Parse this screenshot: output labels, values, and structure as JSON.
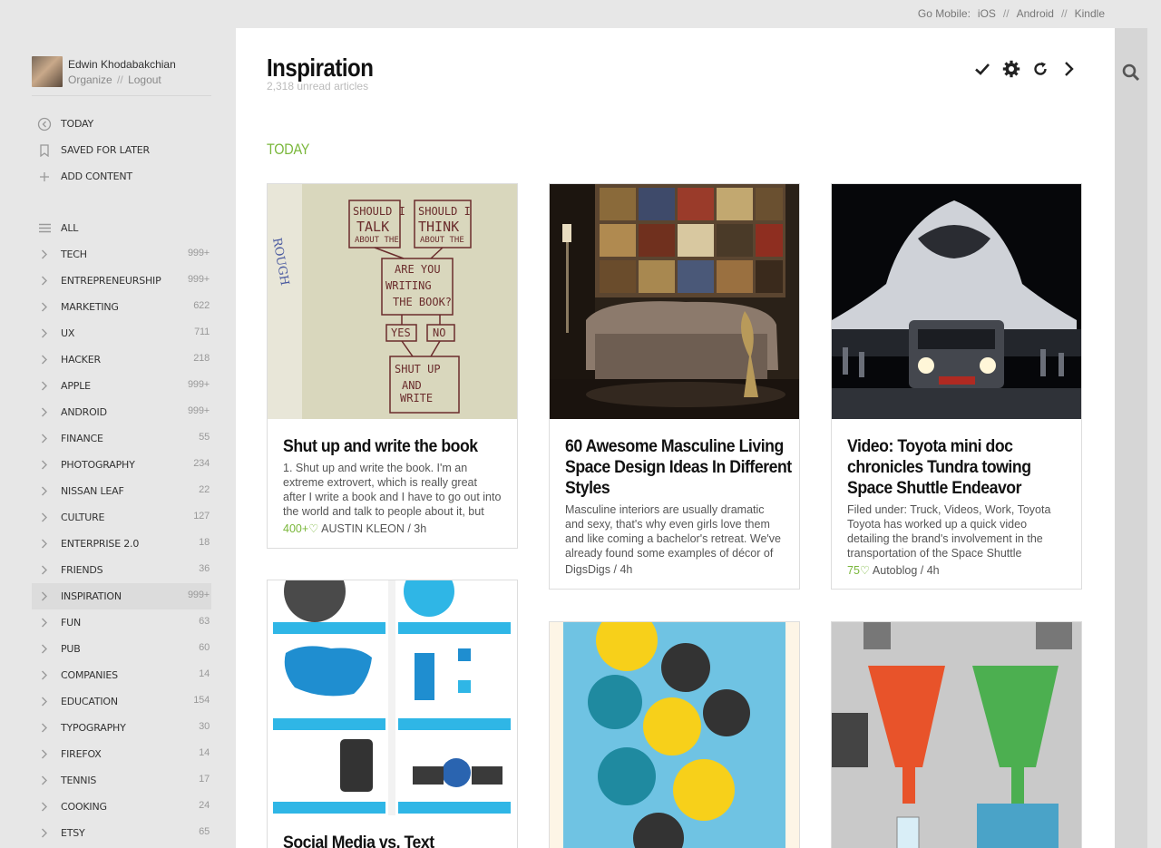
{
  "topbar": {
    "label": "Go Mobile:",
    "links": [
      "iOS",
      "Android",
      "Kindle"
    ],
    "separator": "//"
  },
  "user": {
    "name": "Edwin Khodabakchian",
    "organize": "Organize",
    "separator": "//",
    "logout": "Logout"
  },
  "nav_top": [
    {
      "label": "TODAY",
      "icon": "today-icon"
    },
    {
      "label": "SAVED FOR LATER",
      "icon": "bookmark-icon"
    },
    {
      "label": "ADD CONTENT",
      "icon": "plus-icon"
    }
  ],
  "nav_list": [
    {
      "label": "ALL",
      "count": "",
      "icon": "list-icon"
    },
    {
      "label": "TECH",
      "count": "999+"
    },
    {
      "label": "ENTREPRENEURSHIP",
      "count": "999+"
    },
    {
      "label": "MARKETING",
      "count": "622"
    },
    {
      "label": "UX",
      "count": "711"
    },
    {
      "label": "HACKER",
      "count": "218"
    },
    {
      "label": "APPLE",
      "count": "999+"
    },
    {
      "label": "ANDROID",
      "count": "999+"
    },
    {
      "label": "FINANCE",
      "count": "55"
    },
    {
      "label": "PHOTOGRAPHY",
      "count": "234"
    },
    {
      "label": "NISSAN LEAF",
      "count": "22"
    },
    {
      "label": "CULTURE",
      "count": "127"
    },
    {
      "label": "ENTERPRISE 2.0",
      "count": "18"
    },
    {
      "label": "FRIENDS",
      "count": "36"
    },
    {
      "label": "INSPIRATION",
      "count": "999+",
      "active": true
    },
    {
      "label": "FUN",
      "count": "63"
    },
    {
      "label": "PUB",
      "count": "60"
    },
    {
      "label": "COMPANIES",
      "count": "14"
    },
    {
      "label": "EDUCATION",
      "count": "154"
    },
    {
      "label": "TYPOGRAPHY",
      "count": "30"
    },
    {
      "label": "FIREFOX",
      "count": "14"
    },
    {
      "label": "TENNIS",
      "count": "17"
    },
    {
      "label": "COOKING",
      "count": "24"
    },
    {
      "label": "ETSY",
      "count": "65"
    }
  ],
  "main": {
    "title": "Inspiration",
    "subtitle": "2,318 unread articles",
    "section": "TODAY",
    "actions": [
      "checkmark-icon",
      "gear-icon",
      "refresh-icon",
      "chevron-right-icon"
    ]
  },
  "cards": [
    {
      "title": "Shut up and write the book",
      "summary": "1. Shut up and write the book. I'm an extreme extrovert, which is really great after I write a book and I have to go out into the world and talk to people about it, but not so",
      "saves": "400+",
      "source": "AUSTIN KLEON",
      "time": "3h",
      "image": "flowchart-sketch"
    },
    {
      "title": "60 Awesome Masculine Living Space Design Ideas In Different Styles",
      "summary": "Masculine interiors are usually dramatic and sexy, that's why even girls love them and like coming a bachelor's retreat. We've already found some examples of décor of",
      "saves": "",
      "source": "DigsDigs",
      "time": "4h",
      "image": "living-room"
    },
    {
      "title": "Video: Toyota mini doc chronicles Tundra towing Space Shuttle Endeavor",
      "summary": "Filed under: Truck, Videos, Work, Toyota Toyota has worked up a quick video detailing the brand's involvement in the transportation of the Space Shuttle",
      "saves": "75",
      "source": "Autoblog",
      "time": "4h",
      "image": "space-shuttle"
    },
    {
      "title": "Social Media vs. Text",
      "summary": "",
      "saves": "",
      "source": "",
      "time": "",
      "image": "infographic-social"
    },
    {
      "title": "",
      "summary": "",
      "saves": "",
      "source": "",
      "time": "",
      "image": "infographic-crowdsourced"
    },
    {
      "title": "",
      "summary": "",
      "saves": "",
      "source": "",
      "time": "",
      "image": "infographic-funnels"
    }
  ],
  "colors": {
    "accent": "#7ab73b",
    "sidebar_bg": "#e7e7e7",
    "rail_bg": "#d6d6d6"
  }
}
